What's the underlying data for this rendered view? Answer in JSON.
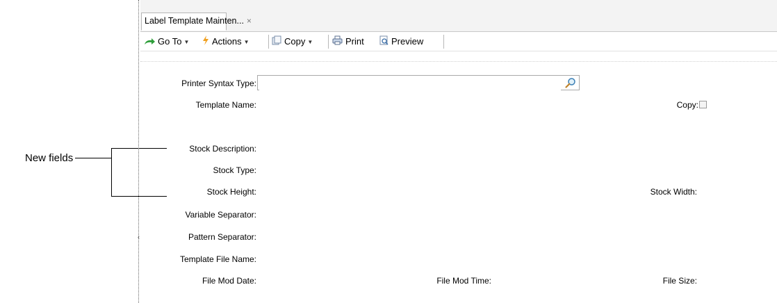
{
  "annotation": {
    "label": "New fields"
  },
  "tab": {
    "title": "Label Template Mainten...",
    "close": "×"
  },
  "toolbar": {
    "goto_label": "Go To",
    "actions_label": "Actions",
    "copy_label": "Copy",
    "print_label": "Print",
    "preview_label": "Preview"
  },
  "form": {
    "printer_syntax_type_label": "Printer Syntax Type:",
    "printer_syntax_type_value": "",
    "template_name_label": "Template Name:",
    "copy_label": "Copy:",
    "copy_checked": false,
    "stock_description_label": "Stock Description:",
    "stock_type_label": "Stock Type:",
    "stock_height_label": "Stock Height:",
    "stock_width_label": "Stock Width:",
    "variable_separator_label": "Variable Separator:",
    "pattern_separator_label": "Pattern Separator:",
    "template_file_name_label": "Template File Name:",
    "file_mod_date_label": "File Mod Date:",
    "file_mod_time_label": "File Mod Time:",
    "file_size_label": "File Size:"
  },
  "colors": {
    "goto_icon": "#2e9e3a",
    "actions_icon": "#f0a020",
    "tab_border": "#b6b6b6"
  }
}
